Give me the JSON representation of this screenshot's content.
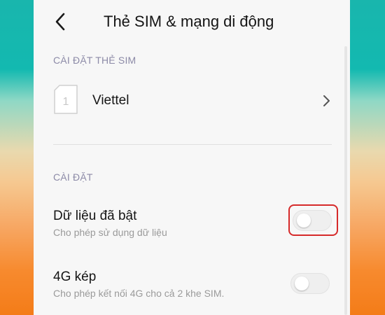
{
  "header": {
    "back_icon": "chevron-left-icon",
    "title": "Thẻ SIM & mạng di động"
  },
  "sim_section": {
    "header": "CÀI ĐẶT THẺ SIM",
    "sim": {
      "slot_number": "1",
      "name": "Viettel",
      "icon": "sim-card-icon",
      "chevron_icon": "chevron-right-icon"
    }
  },
  "settings_section": {
    "header": "CÀI ĐẶT",
    "items": [
      {
        "title": "Dữ liệu đã bật",
        "subtitle": "Cho phép sử dụng dữ liệu",
        "toggle_on": false,
        "highlighted": true
      },
      {
        "title": "4G kép",
        "subtitle": "Cho phép kết nối 4G cho cả 2 khe SIM.",
        "toggle_on": false,
        "highlighted": false
      }
    ]
  },
  "colors": {
    "background": "#f7f7f7",
    "section_header": "#8c8aa7",
    "highlight_border": "#d62a2a"
  }
}
